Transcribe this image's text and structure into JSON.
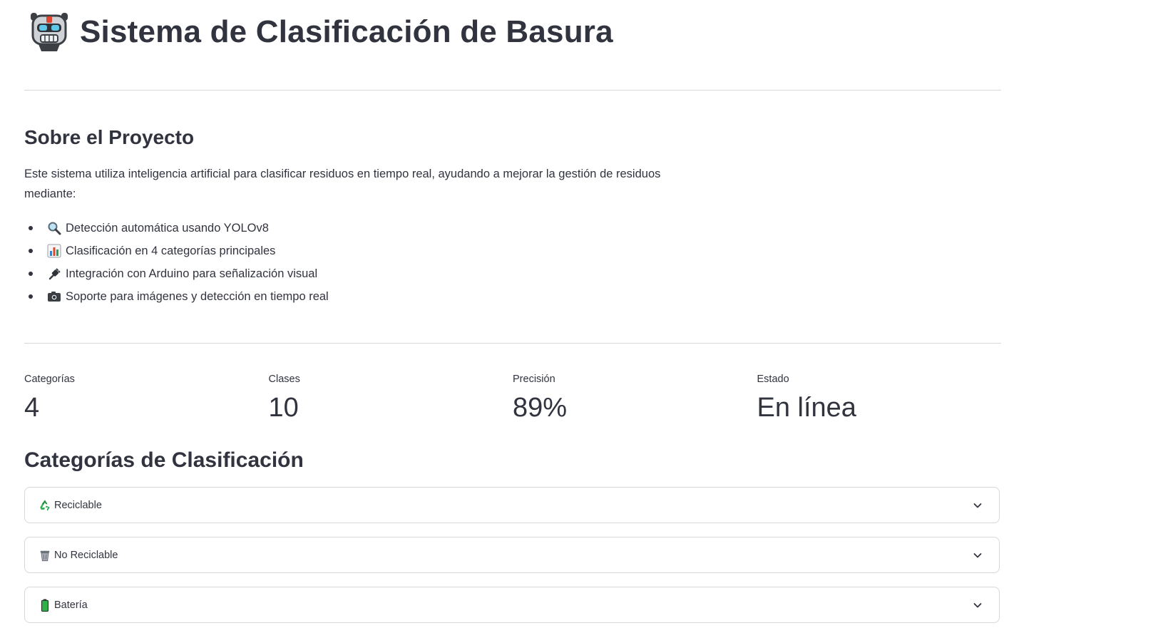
{
  "header": {
    "title": "Sistema de Clasificación de Basura",
    "icon": "robot-icon"
  },
  "about": {
    "heading": "Sobre el Proyecto",
    "intro": "Este sistema utiliza inteligencia artificial para clasificar residuos en tiempo real, ayudando a mejorar la gestión de residuos mediante:",
    "features": [
      {
        "icon": "magnifier-icon",
        "label": "Detección automática usando YOLOv8"
      },
      {
        "icon": "bar-chart-icon",
        "label": "Clasificación en 4 categorías principales"
      },
      {
        "icon": "plug-icon",
        "label": "Integración con Arduino para señalización visual"
      },
      {
        "icon": "camera-icon",
        "label": "Soporte para imágenes y detección en tiempo real"
      }
    ]
  },
  "metrics": [
    {
      "label": "Categorías",
      "value": "4"
    },
    {
      "label": "Clases",
      "value": "10"
    },
    {
      "label": "Precisión",
      "value": "89%"
    },
    {
      "label": "Estado",
      "value": "En línea"
    }
  ],
  "categories": {
    "heading": "Categorías de Clasificación",
    "items": [
      {
        "icon": "recycle-icon",
        "label": "Reciclable",
        "expanded": false
      },
      {
        "icon": "trash-icon",
        "label": "No Reciclable",
        "expanded": false
      },
      {
        "icon": "battery-icon",
        "label": "Batería",
        "expanded": false
      }
    ]
  },
  "colors": {
    "text": "#31333f",
    "border": "#d7d8db",
    "background": "#ffffff"
  }
}
